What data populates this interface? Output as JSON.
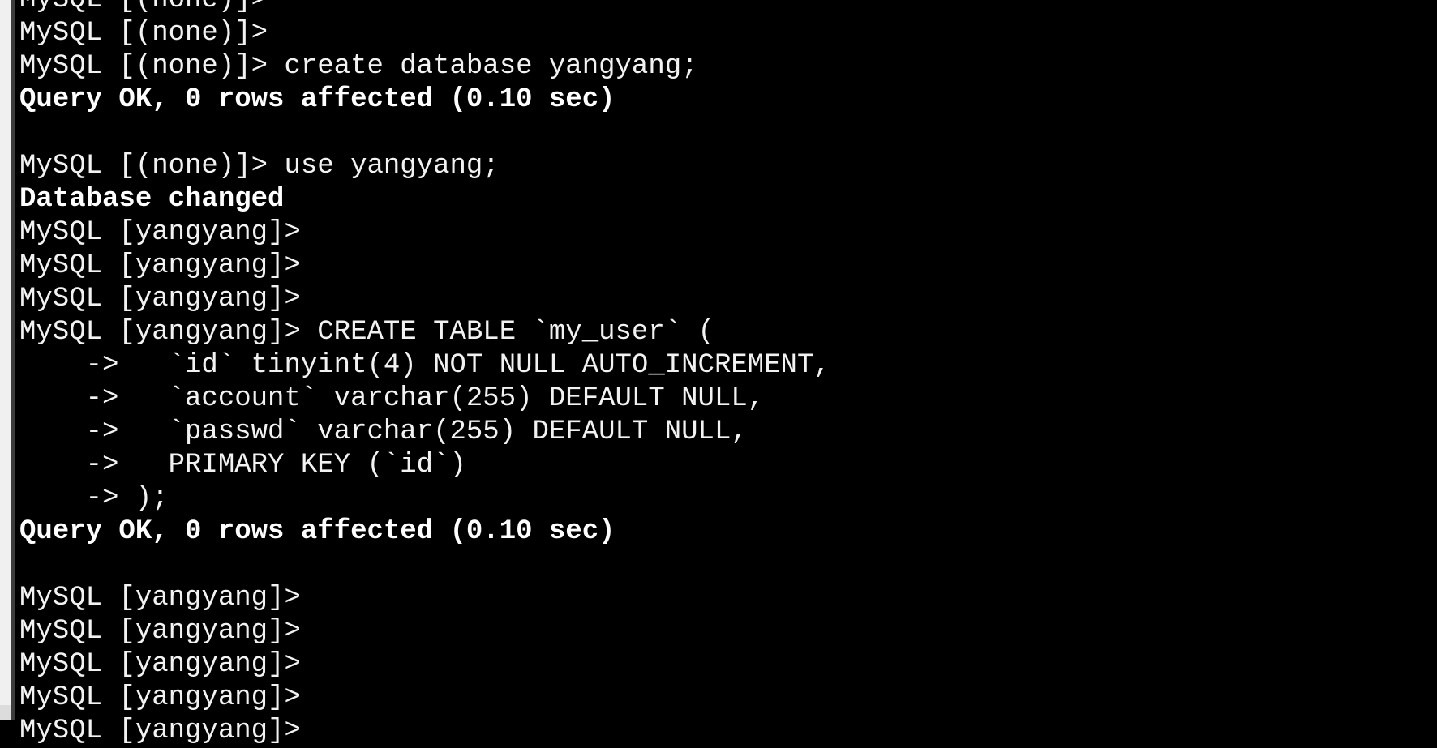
{
  "terminal": {
    "colors": {
      "background": "#000000",
      "foreground": "#f2f2f2"
    },
    "lines": [
      {
        "text": "MySQL [(none)]>",
        "bold": false
      },
      {
        "text": "MySQL [(none)]>",
        "bold": false
      },
      {
        "text": "MySQL [(none)]> create database yangyang;",
        "bold": false
      },
      {
        "text": "Query OK, 0 rows affected (0.10 sec)",
        "bold": true
      },
      {
        "text": "",
        "bold": false
      },
      {
        "text": "MySQL [(none)]> use yangyang;",
        "bold": false
      },
      {
        "text": "Database changed",
        "bold": true
      },
      {
        "text": "MySQL [yangyang]>",
        "bold": false
      },
      {
        "text": "MySQL [yangyang]>",
        "bold": false
      },
      {
        "text": "MySQL [yangyang]>",
        "bold": false
      },
      {
        "text": "MySQL [yangyang]> CREATE TABLE `my_user` (",
        "bold": false
      },
      {
        "text": "    ->   `id` tinyint(4) NOT NULL AUTO_INCREMENT,",
        "bold": false
      },
      {
        "text": "    ->   `account` varchar(255) DEFAULT NULL,",
        "bold": false
      },
      {
        "text": "    ->   `passwd` varchar(255) DEFAULT NULL,",
        "bold": false
      },
      {
        "text": "    ->   PRIMARY KEY (`id`)",
        "bold": false
      },
      {
        "text": "    -> );",
        "bold": false
      },
      {
        "text": "Query OK, 0 rows affected (0.10 sec)",
        "bold": true
      },
      {
        "text": "",
        "bold": false
      },
      {
        "text": "MySQL [yangyang]>",
        "bold": false
      },
      {
        "text": "MySQL [yangyang]>",
        "bold": false
      },
      {
        "text": "MySQL [yangyang]>",
        "bold": false
      },
      {
        "text": "MySQL [yangyang]>",
        "bold": false
      },
      {
        "text": "MySQL [yangyang]>",
        "bold": false
      }
    ]
  }
}
